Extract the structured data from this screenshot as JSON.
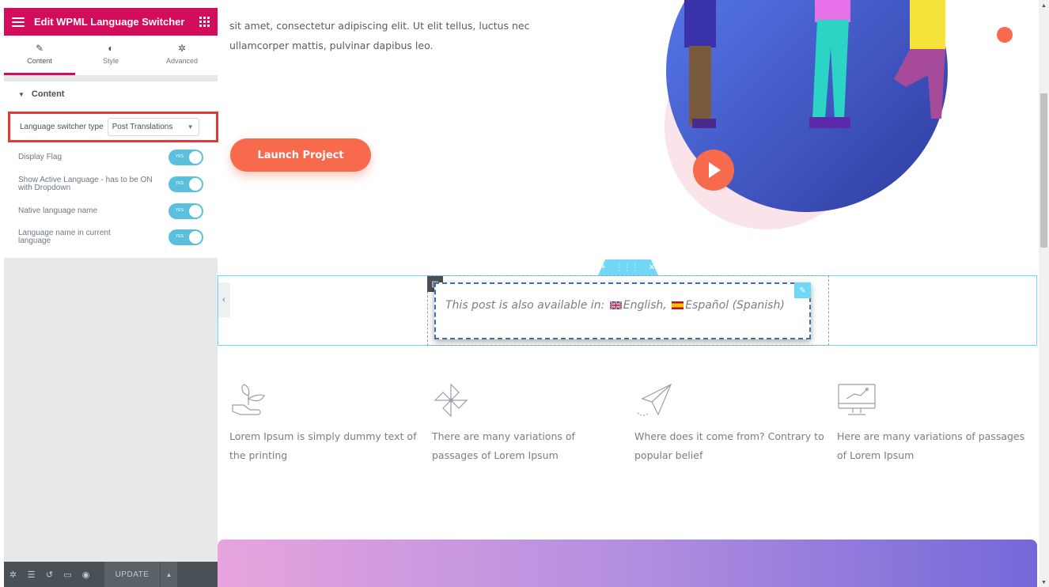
{
  "sidebar": {
    "title": "Edit WPML Language Switcher",
    "tabs": [
      {
        "label": "Content",
        "icon": "pencil-icon"
      },
      {
        "label": "Style",
        "icon": "half-circle-icon"
      },
      {
        "label": "Advanced",
        "icon": "gear-icon"
      }
    ],
    "section_title": "Content",
    "switcher_type_label": "Language switcher type",
    "switcher_type_value": "Post Translations",
    "toggles": [
      {
        "label": "Display Flag",
        "state": "YES"
      },
      {
        "label": "Show Active Language - has to be ON with Dropdown",
        "state": "YES"
      },
      {
        "label": "Native language name",
        "state": "YES"
      },
      {
        "label": "Language name in current language",
        "state": "YES"
      }
    ],
    "footer": {
      "update_label": "UPDATE"
    }
  },
  "canvas": {
    "hero_text": "sit amet, consectetur adipiscing elit. Ut elit tellus, luctus nec ullamcorper mattis, pulvinar dapibus leo.",
    "launch_button": "Launch Project",
    "lang_switcher": {
      "prefix": "This post is also available in:",
      "lang1": "English,",
      "lang2": "Español (Spanish)"
    },
    "features": [
      {
        "icon": "plant-hand-icon",
        "text": "Lorem Ipsum is simply dummy text of the printing"
      },
      {
        "icon": "pinwheel-icon",
        "text": "There are many variations of passages of Lorem Ipsum"
      },
      {
        "icon": "paper-plane-icon",
        "text": "Where does it come from? Contrary to popular belief"
      },
      {
        "icon": "monitor-chart-icon",
        "text": "Here are many variations of passages of Lorem Ipsum"
      }
    ]
  },
  "colors": {
    "brand": "#d30c5c",
    "accent": "#71d7f7",
    "toggle": "#5bc0de",
    "button": "#f76a4c",
    "highlight": "#e53935"
  }
}
